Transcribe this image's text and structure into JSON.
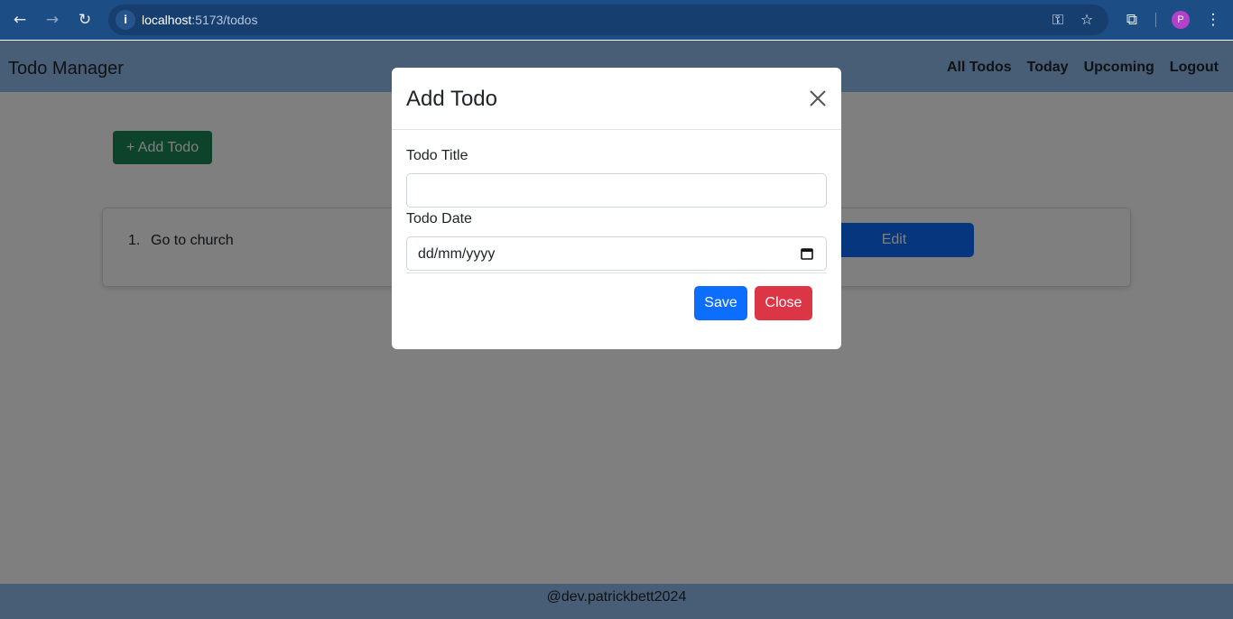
{
  "browser": {
    "url_host": "localhost",
    "url_path": ":5173/todos",
    "avatar_letter": "P",
    "back_icon": "arrow-left-icon",
    "forward_icon": "arrow-right-icon",
    "reload_icon": "reload-icon"
  },
  "app": {
    "brand": "Todo Manager",
    "nav": [
      "All Todos",
      "Today",
      "Upcoming",
      "Logout"
    ],
    "add_button": "+ Add Todo",
    "todos": [
      {
        "number": "1.",
        "title": "Go to church",
        "edit_label": "Edit"
      }
    ],
    "footer": "@dev.patrickbett2024"
  },
  "modal": {
    "title": "Add Todo",
    "title_label": "Todo Title",
    "title_value": "",
    "date_label": "Todo Date",
    "date_placeholder": "dd/mm/yyyy",
    "save_label": "Save",
    "close_label": "Close"
  },
  "colors": {
    "browser_bar": "#1c4d85",
    "navbar": "#90bcef",
    "success": "#198754",
    "primary": "#0d6efd",
    "danger": "#dc3545"
  }
}
